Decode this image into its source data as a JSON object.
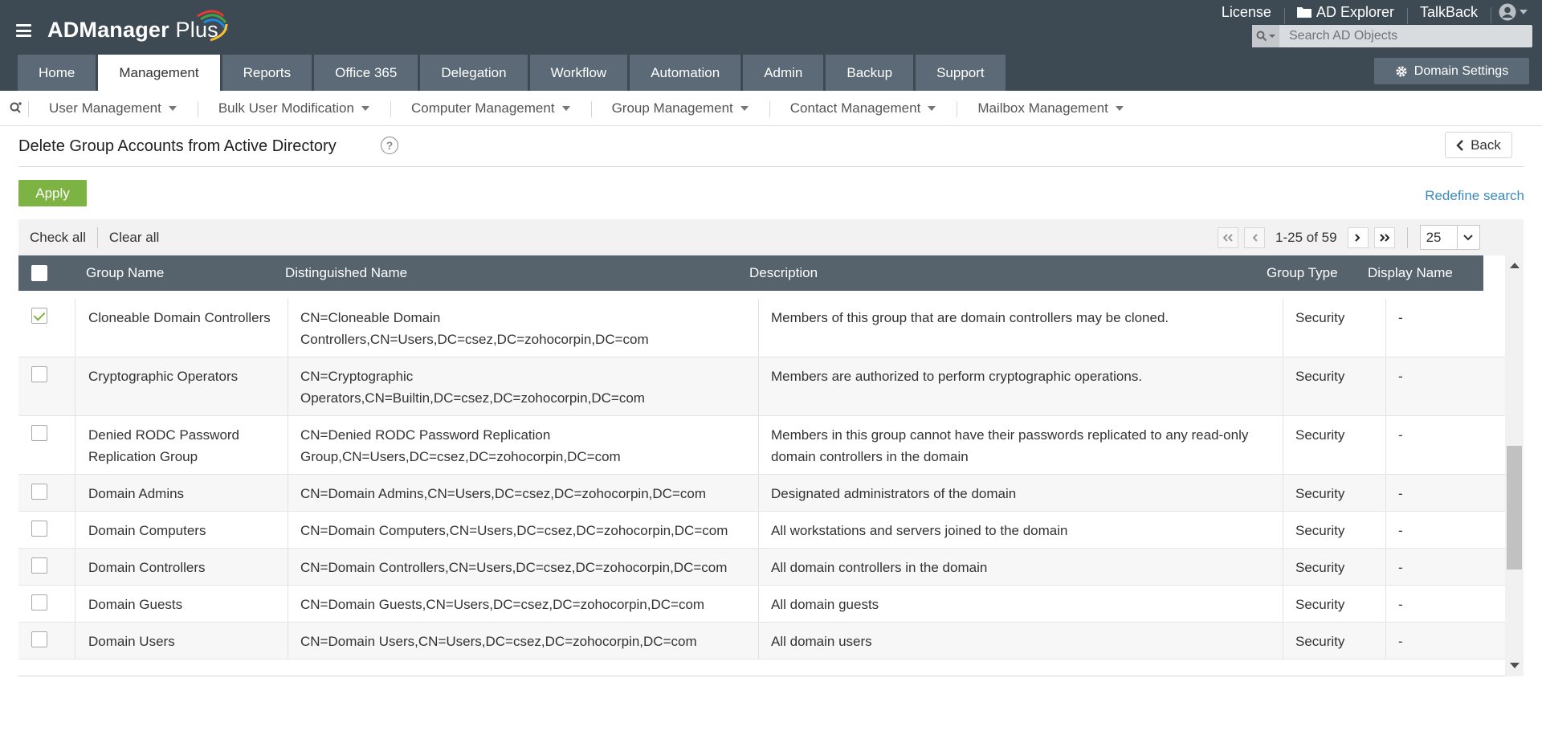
{
  "app": {
    "logo_text": "ADManager",
    "logo_suffix": "Plus",
    "colors": {
      "header_bg": "#3e4a53",
      "tab_bg": "#5b6a76",
      "apply_green": "#7cb342",
      "link_blue": "#3a8bbb",
      "table_header_bg": "#56626c"
    }
  },
  "top_links": {
    "license": "License",
    "ad_explorer": "AD Explorer",
    "talkback": "TalkBack"
  },
  "search": {
    "placeholder": "Search AD Objects"
  },
  "tabs": [
    {
      "label": "Home"
    },
    {
      "label": "Management",
      "active": true
    },
    {
      "label": "Reports"
    },
    {
      "label": "Office 365"
    },
    {
      "label": "Delegation"
    },
    {
      "label": "Workflow"
    },
    {
      "label": "Automation"
    },
    {
      "label": "Admin"
    },
    {
      "label": "Backup"
    },
    {
      "label": "Support"
    }
  ],
  "domain_settings_label": "Domain Settings",
  "subnav": [
    {
      "label": "User Management"
    },
    {
      "label": "Bulk User Modification"
    },
    {
      "label": "Computer Management"
    },
    {
      "label": "Group Management"
    },
    {
      "label": "Contact Management"
    },
    {
      "label": "Mailbox Management"
    }
  ],
  "page": {
    "title": "Delete Group Accounts from Active Directory",
    "help": "?",
    "back_label": "Back",
    "apply_label": "Apply",
    "redefine_label": "Redefine search"
  },
  "toolbar": {
    "check_all": "Check all",
    "clear_all": "Clear all",
    "page_info": "1-25 of 59",
    "per_page": "25"
  },
  "table": {
    "columns": [
      "Group Name",
      "Distinguished Name",
      "Description",
      "Group Type",
      "Display Name"
    ],
    "rows": [
      {
        "checked": true,
        "name": "Cloneable Domain Controllers",
        "dn": "CN=Cloneable Domain Controllers,CN=Users,DC=csez,DC=zohocorpin,DC=com",
        "desc": "Members of this group that are domain controllers may be cloned.",
        "type": "Security",
        "display": "-"
      },
      {
        "checked": false,
        "name": "Cryptographic Operators",
        "dn": "CN=Cryptographic Operators,CN=Builtin,DC=csez,DC=zohocorpin,DC=com",
        "desc": "Members are authorized to perform cryptographic operations.",
        "type": "Security",
        "display": "-"
      },
      {
        "checked": false,
        "name": "Denied RODC Password Replication Group",
        "dn": "CN=Denied RODC Password Replication Group,CN=Users,DC=csez,DC=zohocorpin,DC=com",
        "desc": "Members in this group cannot have their passwords replicated to any read-only domain controllers in the domain",
        "type": "Security",
        "display": "-"
      },
      {
        "checked": false,
        "name": "Domain Admins",
        "dn": "CN=Domain Admins,CN=Users,DC=csez,DC=zohocorpin,DC=com",
        "desc": "Designated administrators of the domain",
        "type": "Security",
        "display": "-"
      },
      {
        "checked": false,
        "name": "Domain Computers",
        "dn": "CN=Domain Computers,CN=Users,DC=csez,DC=zohocorpin,DC=com",
        "desc": "All workstations and servers joined to the domain",
        "type": "Security",
        "display": "-"
      },
      {
        "checked": false,
        "name": "Domain Controllers",
        "dn": "CN=Domain Controllers,CN=Users,DC=csez,DC=zohocorpin,DC=com",
        "desc": "All domain controllers in the domain",
        "type": "Security",
        "display": "-"
      },
      {
        "checked": false,
        "name": "Domain Guests",
        "dn": "CN=Domain Guests,CN=Users,DC=csez,DC=zohocorpin,DC=com",
        "desc": "All domain guests",
        "type": "Security",
        "display": "-"
      },
      {
        "checked": false,
        "name": "Domain Users",
        "dn": "CN=Domain Users,CN=Users,DC=csez,DC=zohocorpin,DC=com",
        "desc": "All domain users",
        "type": "Security",
        "display": "-"
      }
    ]
  }
}
